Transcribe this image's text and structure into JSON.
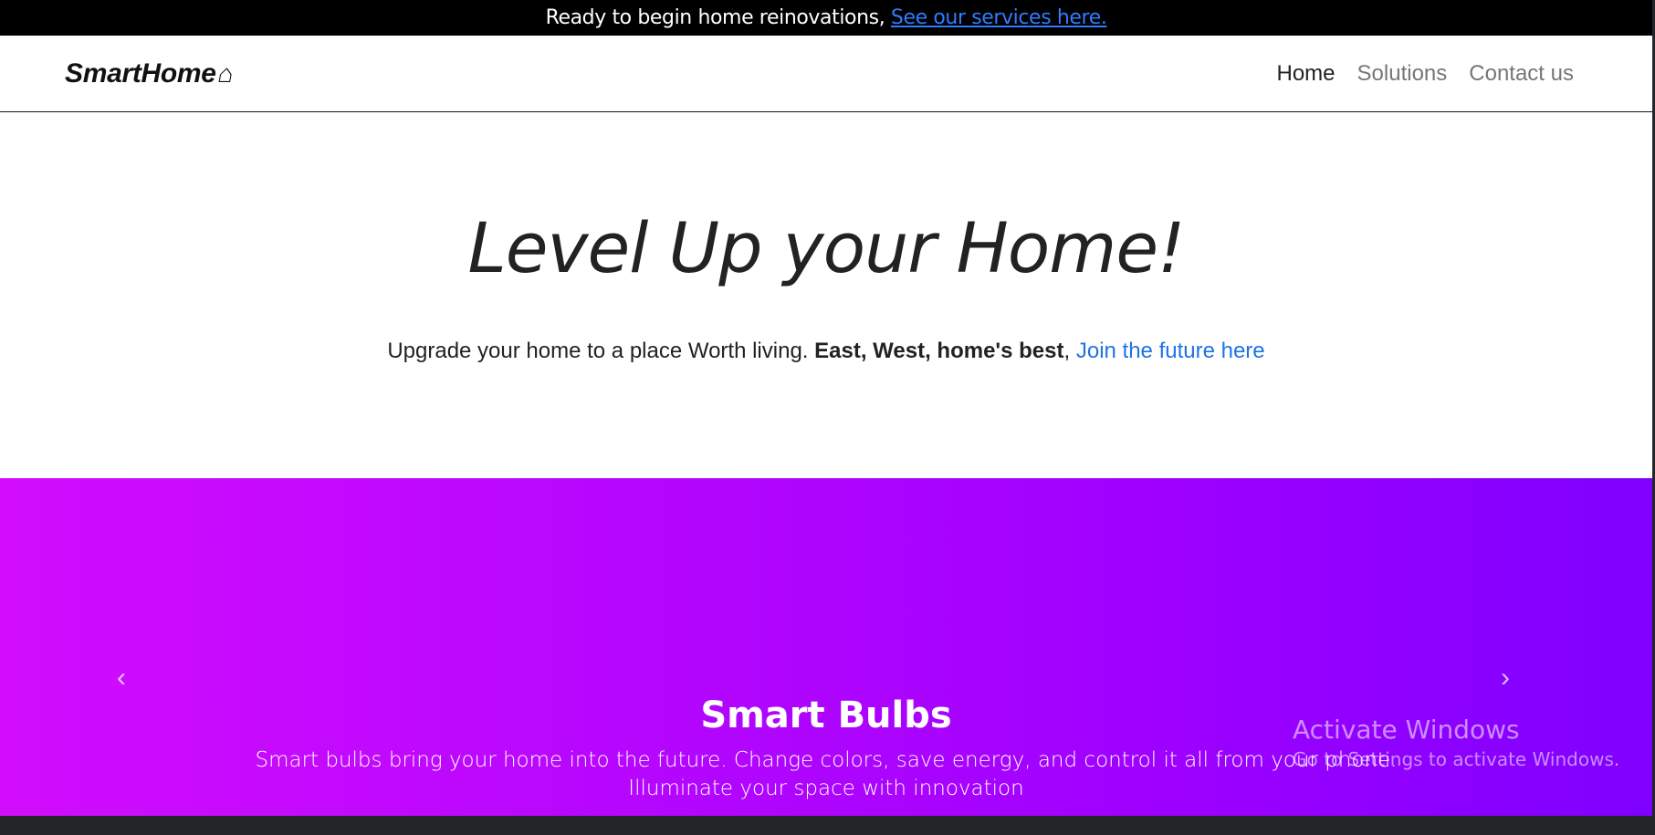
{
  "announcement": {
    "text": "Ready to begin home reinovations, ",
    "link_text": "See our services here."
  },
  "header": {
    "brand": "SmartHome",
    "brand_icon": "⌂",
    "nav": [
      "Home",
      "Solutions",
      "Contact us"
    ]
  },
  "hero": {
    "title": "Level Up your Home!",
    "lead_text": "Upgrade your home to a place Worth living. ",
    "strong_text": "East, West, home's best",
    "separator": ", ",
    "link_text": "Join the future here"
  },
  "carousel": {
    "title": "Smart Bulbs",
    "description": "Smart bulbs bring your home into the future. Change colors, save energy, and control it all from your phone. Illuminate your space with innovation",
    "prev_icon": "‹",
    "next_icon": "›"
  },
  "activation_watermark": {
    "title": "Activate Windows",
    "subtitle": "Go to Settings to activate Windows."
  }
}
